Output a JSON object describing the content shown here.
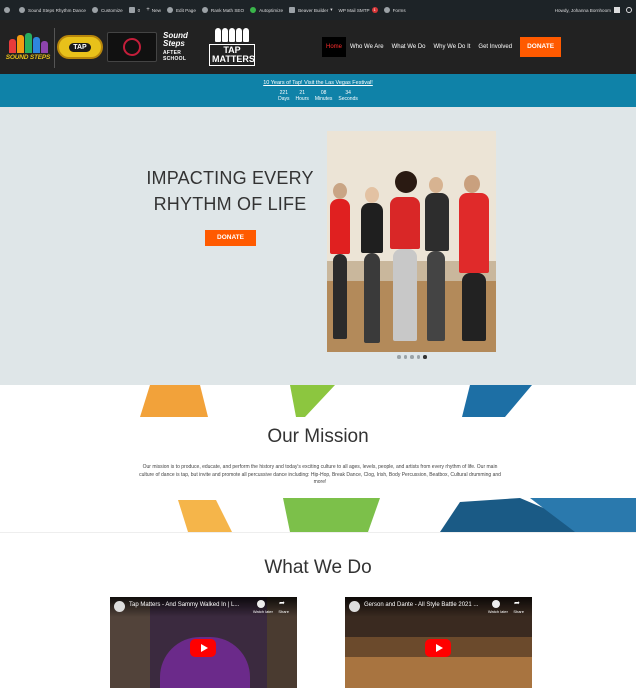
{
  "adminbar": {
    "site_name": "Sound Steps Rhythm Dance",
    "customize": "Customize",
    "comments_count": "0",
    "new": "New",
    "edit_page": "Edit Page",
    "seo": "Rank Math SEO",
    "autoptimize": "Autoptimize",
    "builder": "Beaver Builder",
    "smtp": "WP Mail SMTP",
    "smtp_badge": "1",
    "forms": "Forms",
    "howdy": "Howdy, Johanna Bornhoom"
  },
  "header": {
    "logos": {
      "sound_steps": "SOUND STEPS",
      "tap": "TAP",
      "after_school_line1": "Sound",
      "after_school_line2": "Steps",
      "after_school_line3": "AFTER SCHOOL",
      "tap_matters_line1": "TAP",
      "tap_matters_line2": "MATTERS"
    },
    "nav": [
      "Home",
      "Who We Are",
      "What We Do",
      "Why We Do It",
      "Get Involved"
    ],
    "donate": "DONATE"
  },
  "countdown": {
    "link_text": "10 Years of Tap! Visit the Las Vegas Festival!",
    "units": [
      {
        "value": "221",
        "label": "Days"
      },
      {
        "value": "21",
        "label": "Hours"
      },
      {
        "value": "08",
        "label": "Minutes"
      },
      {
        "value": "34",
        "label": "Seconds"
      }
    ]
  },
  "hero": {
    "title_line1": "IMPACTING EVERY",
    "title_line2": "RHYTHM OF LIFE",
    "donate": "DONATE",
    "slide_count": 5,
    "active_slide": 5
  },
  "mission": {
    "title": "Our Mission",
    "text": "Our mission is to produce, educate, and perform the history and today's exciting culture to all ages, levels, people, and artists from every rhythm of life. Our main culture of dance is tap, but invite and promote all percussive dance including: Hip-Hop, Break Dance, Clog, Irish, Body Percussion, Beatbox, Cultural drumming and more!"
  },
  "what_we_do": {
    "title": "What We Do",
    "videos": [
      {
        "title": "Tap Matters - And Sammy Walked In | L...",
        "watch_later": "Watch later",
        "share": "Share"
      },
      {
        "title": "Gerson and Dante - All Style Battle 2021 ...",
        "watch_later": "Watch later",
        "share": "Share"
      }
    ]
  },
  "colors": {
    "accent": "#ff5a00",
    "header_bg": "#222222",
    "countdown_bg": "#0f82a8",
    "hero_bg": "#dfe6e8"
  }
}
